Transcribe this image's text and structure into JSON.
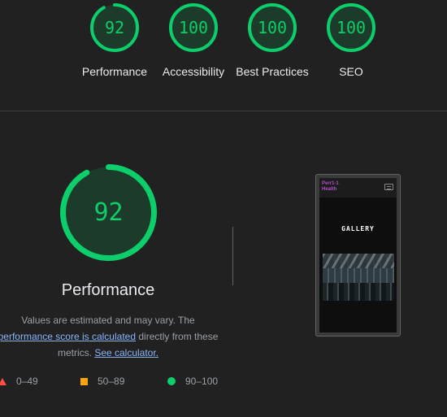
{
  "categories": [
    {
      "score": "92",
      "value": 92,
      "label": "Performance"
    },
    {
      "score": "100",
      "value": 100,
      "label": "Accessibility"
    },
    {
      "score": "100",
      "value": 100,
      "label": "Best Practices"
    },
    {
      "score": "100",
      "value": 100,
      "label": "SEO"
    }
  ],
  "performance": {
    "score": "92",
    "value": 92,
    "title": "Performance",
    "desc_part1": "Values are estimated and may vary. The",
    "desc_link1": "performance score is calculated",
    "desc_part2": "directly from these metrics.",
    "desc_link2": "See calculator."
  },
  "legend": [
    {
      "label": "0–49",
      "color": "#ff4e42",
      "icon": "triangle-icon"
    },
    {
      "label": "50–89",
      "color": "#ffa400",
      "icon": "square-icon"
    },
    {
      "label": "90–100",
      "color": "#0cce6b",
      "icon": "circle-icon"
    }
  ],
  "screenshot": {
    "logo_line1": "Perr1-1",
    "logo_line2": "Health",
    "heading": "GALLERY"
  },
  "colors": {
    "pass": "#0cce6b",
    "pass_bg": "#1c3b2a",
    "background": "#212121"
  }
}
